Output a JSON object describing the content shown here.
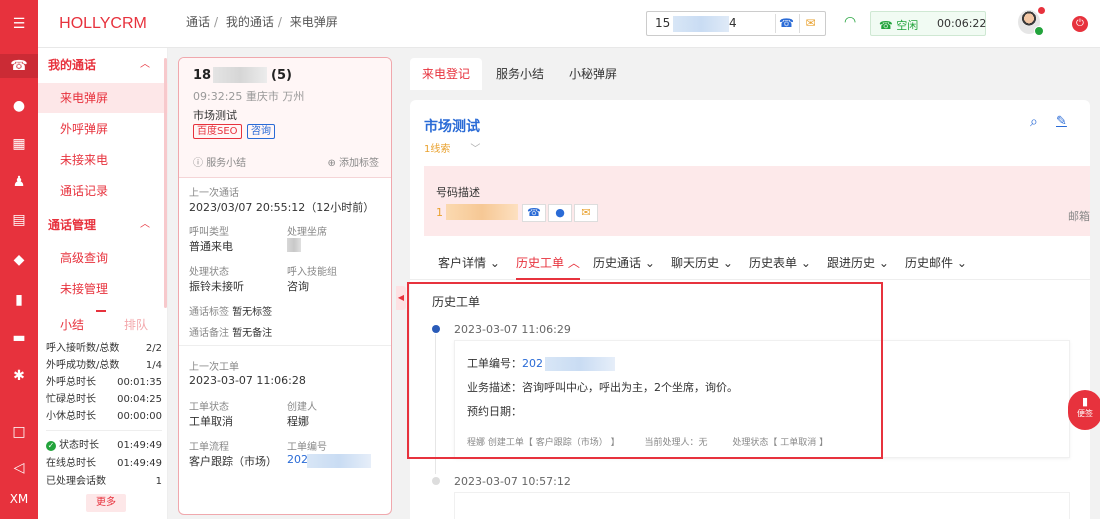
{
  "brand": "HOLLYCRM",
  "breadcrumb": [
    "通话",
    "我的通话",
    "来电弹屏"
  ],
  "phone": {
    "prefix": "15",
    "suffix": "4"
  },
  "status": {
    "label": "空闲",
    "timer": "00:06:22"
  },
  "rail": {
    "bottom_label": "XM"
  },
  "menu": {
    "groups": [
      {
        "label": "我的通话",
        "items": [
          "来电弹屏",
          "外呼弹屏",
          "未接来电",
          "通话记录"
        ]
      },
      {
        "label": "通话管理",
        "items": [
          "高级查询",
          "未接管理"
        ]
      }
    ],
    "summary_tabs": [
      "小结",
      "排队"
    ],
    "stats": [
      {
        "label": "呼入接听数/总数",
        "value": "2/2"
      },
      {
        "label": "外呼成功数/总数",
        "value": "1/4"
      },
      {
        "label": "外呼总时长",
        "value": "00:01:35"
      },
      {
        "label": "忙碌总时长",
        "value": "00:04:25"
      },
      {
        "label": "小休总时长",
        "value": "00:00:00"
      },
      {
        "label": "状态时长",
        "value": "01:49:49"
      },
      {
        "label": "在线总时长",
        "value": "01:49:49"
      },
      {
        "label": "已处理会话数",
        "value": "1"
      }
    ],
    "more": "更多"
  },
  "caller": {
    "name_prefix": "18",
    "count": "(5)",
    "time_location": "09:32:25 重庆市 万州",
    "type": "市场测试",
    "tags": [
      "百度SEO",
      "咨询"
    ],
    "service_summary": "服务小结",
    "add_tag": "添加标签",
    "last_call": {
      "title": "上一次通话",
      "time": "2023/03/07 20:55:12（12小时前）",
      "call_type_label": "呼叫类型",
      "call_type": "普通来电",
      "agent_label": "处理坐席",
      "status_label": "处理状态",
      "status": "振铃未接听",
      "skill_label": "呼入技能组",
      "skill": "咨询",
      "tag_label": "通话标签",
      "tag_value": "暂无标签",
      "note_label": "通话备注",
      "note_value": "暂无备注"
    },
    "last_order": {
      "title": "上一次工单",
      "time": "2023-03-07 11:06:28",
      "status_label": "工单状态",
      "status": "工单取消",
      "creator_label": "创建人",
      "creator": "程娜",
      "flow_label": "工单流程",
      "flow": "客户跟踪（市场）",
      "number_label": "工单编号",
      "number_prefix": "202"
    }
  },
  "main_tabs": [
    "来电登记",
    "服务小结",
    "小秘弹屏"
  ],
  "card": {
    "title": "市场测试",
    "subtitle": "1线索",
    "phone_desc_label": "号码描述",
    "phone_prefix": "1",
    "mailbox": "邮箱"
  },
  "sub_tabs": [
    "客户详情",
    "历史工单",
    "历史通话",
    "聊天历史",
    "历史表单",
    "跟进历史",
    "历史邮件"
  ],
  "history": {
    "title": "历史工单",
    "entries": [
      {
        "date": "2023-03-07 11:06:29",
        "number_label": "工单编号：",
        "number_prefix": "202",
        "desc_label": "业务描述：",
        "desc": "咨询呼叫中心，呼出为主，2个坐席，询价。",
        "appt_label": "预约日期：",
        "footer_creator": "程娜 创建工单【 客户跟踪（市场） 】",
        "footer_handler": "当前处理人：无",
        "footer_status": "处理状态【 工单取消 】"
      },
      {
        "date": "2023-03-07 10:57:12"
      }
    ]
  },
  "float_button": "便签",
  "colors": {
    "brand": "#e7323d",
    "link": "#2a6bd6",
    "ok": "#22a33b",
    "warn": "#e9a12e"
  }
}
